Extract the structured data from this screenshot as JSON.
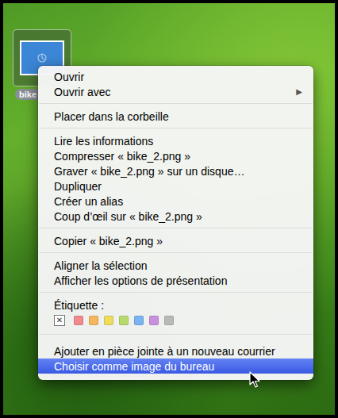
{
  "desktop": {
    "icon": {
      "label": "bike",
      "selected": true
    }
  },
  "context_menu": {
    "groups": [
      {
        "kind": "items",
        "items": [
          {
            "label": "Ouvrir",
            "selected": false
          },
          {
            "label": "Ouvrir avec",
            "selected": false,
            "submenu_glyph": "▶"
          }
        ]
      },
      {
        "kind": "items",
        "items": [
          {
            "label": "Placer dans la corbeille",
            "selected": false
          }
        ]
      },
      {
        "kind": "items",
        "items": [
          {
            "label": "Lire les informations",
            "selected": false
          },
          {
            "label": "Compresser « bike_2.png »",
            "selected": false
          },
          {
            "label": "Graver « bike_2.png » sur un disque…",
            "selected": false
          },
          {
            "label": "Dupliquer",
            "selected": false
          },
          {
            "label": "Créer un alias",
            "selected": false
          },
          {
            "label": "Coup d’œil sur « bike_2.png »",
            "selected": false
          }
        ]
      },
      {
        "kind": "items",
        "items": [
          {
            "label": "Copier « bike_2.png »",
            "selected": false
          }
        ]
      },
      {
        "kind": "items",
        "items": [
          {
            "label": "Aligner la sélection",
            "selected": false
          },
          {
            "label": "Afficher les options de présentation",
            "selected": false
          }
        ]
      },
      {
        "kind": "labels",
        "title": "Étiquette :",
        "options": [
          {
            "kind": "clear",
            "glyph": "✕",
            "selected": true
          },
          {
            "kind": "color",
            "color": "#f08a8c",
            "selected": false
          },
          {
            "kind": "color",
            "color": "#f4b760",
            "selected": false
          },
          {
            "kind": "color",
            "color": "#eedc5c",
            "selected": false
          },
          {
            "kind": "color",
            "color": "#b8da6c",
            "selected": false
          },
          {
            "kind": "color",
            "color": "#7ab3f0",
            "selected": false
          },
          {
            "kind": "color",
            "color": "#c991dd",
            "selected": false
          },
          {
            "kind": "color",
            "color": "#b9b9b9",
            "selected": false
          }
        ]
      },
      {
        "kind": "items",
        "items": [
          {
            "label": "Ajouter en pièce jointe à un nouveau courrier",
            "selected": false
          },
          {
            "label": "Choisir comme image du bureau",
            "selected": true
          }
        ]
      }
    ]
  }
}
